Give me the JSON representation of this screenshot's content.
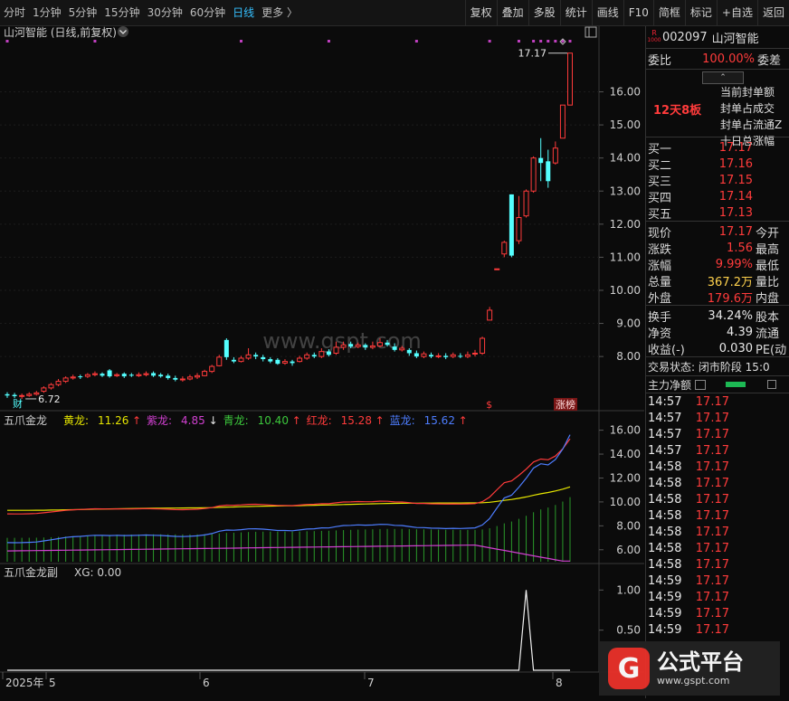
{
  "toolbar": {
    "periods": [
      "分时",
      "1分钟",
      "5分钟",
      "15分钟",
      "30分钟",
      "60分钟",
      "日线",
      "更多 〉"
    ],
    "active_period": "日线",
    "tools": [
      "复权",
      "叠加",
      "多股",
      "统计",
      "画线",
      "F10",
      "简框",
      "标记",
      "+自选",
      "返回"
    ]
  },
  "main_chart": {
    "title": "山河智能 (日线,前复权)",
    "high_label": "17.17",
    "low_label": "6.72",
    "cai_label": "财",
    "s_label": "$",
    "zhangbang_label": "涨榜",
    "watermark": "www.gspt.com",
    "price_axis": [
      "16.00",
      "15.00",
      "14.00",
      "13.00",
      "12.00",
      "11.00",
      "10.00",
      "9.00",
      "8.00"
    ]
  },
  "indicator1": {
    "name": "五爪金龙",
    "lines": [
      {
        "label": "黄龙:",
        "value": "11.26",
        "arrow": "↑",
        "color": "#e6e600"
      },
      {
        "label": "紫龙:",
        "value": "4.85",
        "arrow": "↓",
        "color": "#d040d0"
      },
      {
        "label": "青龙:",
        "value": "10.40",
        "arrow": "↑",
        "color": "#3cc83c"
      },
      {
        "label": "红龙:",
        "value": "15.28",
        "arrow": "↑",
        "color": "#ff3b3b"
      },
      {
        "label": "蓝龙:",
        "value": "15.62",
        "arrow": "↑",
        "color": "#4d7dff"
      }
    ],
    "axis": [
      "16.00",
      "14.00",
      "12.00",
      "10.00",
      "8.00",
      "6.00"
    ]
  },
  "indicator2": {
    "name": "五爪金龙副",
    "xg_label": "XG: 0.00",
    "axis": [
      "1.00",
      "0.50"
    ]
  },
  "time_axis": [
    "2025年",
    "5",
    "6",
    "7",
    "8"
  ],
  "stock": {
    "badge_top": "R",
    "badge_bottom": "1000",
    "code": "002097",
    "name": "山河智能"
  },
  "webi": {
    "label": "委比",
    "value": "100.00%",
    "label2": "委差"
  },
  "seal": {
    "days": "12天8板",
    "items": [
      "当前封单额",
      "封单占成交",
      "封单占流通Z",
      "十日总涨幅"
    ]
  },
  "order_book": [
    {
      "label": "买一",
      "price": "17.17"
    },
    {
      "label": "买二",
      "price": "17.16"
    },
    {
      "label": "买三",
      "price": "17.15"
    },
    {
      "label": "买四",
      "price": "17.14"
    },
    {
      "label": "买五",
      "price": "17.13"
    }
  ],
  "quote": [
    {
      "label": "现价",
      "value": "17.17",
      "color": "red",
      "label2": "今开"
    },
    {
      "label": "涨跌",
      "value": "1.56",
      "color": "red",
      "label2": "最高"
    },
    {
      "label": "涨幅",
      "value": "9.99%",
      "color": "red",
      "label2": "最低"
    },
    {
      "label": "总量",
      "value": "367.2万",
      "color": "yellow",
      "label2": "量比"
    },
    {
      "label": "外盘",
      "value": "179.6万",
      "color": "red",
      "label2": "内盘"
    }
  ],
  "quote2": [
    {
      "label": "换手",
      "value": "34.24%",
      "label2": "股本"
    },
    {
      "label": "净资",
      "value": "4.39",
      "label2": "流通"
    },
    {
      "label": "收益(-)",
      "value": "0.030",
      "label2": "PE(动"
    }
  ],
  "trade_state": "交易状态: 闭市阶段 15:0",
  "net_flow_label": "主力净额",
  "ticks": [
    {
      "time": "14:57",
      "price": "17.17"
    },
    {
      "time": "14:57",
      "price": "17.17"
    },
    {
      "time": "14:57",
      "price": "17.17"
    },
    {
      "time": "14:57",
      "price": "17.17"
    },
    {
      "time": "14:58",
      "price": "17.17"
    },
    {
      "time": "14:58",
      "price": "17.17"
    },
    {
      "time": "14:58",
      "price": "17.17"
    },
    {
      "time": "14:58",
      "price": "17.17"
    },
    {
      "time": "14:58",
      "price": "17.17"
    },
    {
      "time": "14:58",
      "price": "17.17"
    },
    {
      "time": "14:58",
      "price": "17.17"
    },
    {
      "time": "14:59",
      "price": "17.17"
    },
    {
      "time": "14:59",
      "price": "17.17"
    },
    {
      "time": "14:59",
      "price": "17.17"
    },
    {
      "time": "14:59",
      "price": "17.17"
    }
  ],
  "logo": {
    "mark": "G",
    "title": "公式平台",
    "url": "www.gspt.com"
  },
  "chart_data": {
    "type": "candlestick",
    "price_ylim": [
      6.5,
      17.6
    ],
    "candles": [
      [
        6.86,
        6.82,
        6.92,
        6.75
      ],
      [
        6.84,
        6.8,
        6.9,
        6.74
      ],
      [
        6.8,
        6.82,
        6.88,
        6.72
      ],
      [
        6.82,
        6.86,
        6.92,
        6.78
      ],
      [
        6.86,
        6.9,
        6.96,
        6.82
      ],
      [
        6.95,
        7.05,
        7.1,
        6.9
      ],
      [
        7.05,
        7.15,
        7.2,
        7.0
      ],
      [
        7.15,
        7.25,
        7.32,
        7.1
      ],
      [
        7.25,
        7.35,
        7.4,
        7.2
      ],
      [
        7.35,
        7.38,
        7.45,
        7.3
      ],
      [
        7.4,
        7.38,
        7.45,
        7.32
      ],
      [
        7.4,
        7.45,
        7.5,
        7.35
      ],
      [
        7.45,
        7.48,
        7.55,
        7.4
      ],
      [
        7.48,
        7.42,
        7.52,
        7.38
      ],
      [
        7.58,
        7.4,
        7.62,
        7.36
      ],
      [
        7.42,
        7.45,
        7.5,
        7.38
      ],
      [
        7.48,
        7.4,
        7.52,
        7.35
      ],
      [
        7.45,
        7.42,
        7.5,
        7.38
      ],
      [
        7.42,
        7.45,
        7.52,
        7.38
      ],
      [
        7.45,
        7.48,
        7.55,
        7.4
      ],
      [
        7.5,
        7.42,
        7.55,
        7.38
      ],
      [
        7.45,
        7.4,
        7.5,
        7.36
      ],
      [
        7.42,
        7.35,
        7.48,
        7.3
      ],
      [
        7.35,
        7.3,
        7.42,
        7.25
      ],
      [
        7.3,
        7.32,
        7.4,
        7.24
      ],
      [
        7.32,
        7.38,
        7.45,
        7.28
      ],
      [
        7.38,
        7.42,
        7.5,
        7.32
      ],
      [
        7.42,
        7.55,
        7.6,
        7.4
      ],
      [
        7.55,
        7.7,
        7.75,
        7.5
      ],
      [
        7.72,
        7.98,
        8.05,
        7.7
      ],
      [
        8.5,
        7.98,
        8.55,
        7.9
      ],
      [
        7.9,
        7.85,
        7.98,
        7.8
      ],
      [
        7.85,
        7.95,
        8.02,
        7.82
      ],
      [
        7.95,
        8.05,
        8.25,
        7.9
      ],
      [
        8.05,
        8.0,
        8.12,
        7.92
      ],
      [
        7.98,
        7.92,
        8.05,
        7.85
      ],
      [
        7.92,
        7.85,
        7.98,
        7.8
      ],
      [
        7.9,
        7.78,
        7.95,
        7.75
      ],
      [
        7.8,
        7.85,
        7.92,
        7.75
      ],
      [
        7.85,
        7.8,
        7.9,
        7.72
      ],
      [
        7.85,
        7.95,
        8.02,
        7.82
      ],
      [
        7.95,
        8.05,
        8.12,
        7.9
      ],
      [
        8.05,
        8.0,
        8.12,
        7.95
      ],
      [
        8.0,
        8.15,
        8.25,
        7.95
      ],
      [
        8.15,
        8.05,
        8.22,
        8.0
      ],
      [
        8.1,
        8.28,
        8.45,
        8.05
      ],
      [
        8.28,
        8.35,
        8.45,
        8.2
      ],
      [
        8.38,
        8.3,
        8.45,
        8.25
      ],
      [
        8.3,
        8.35,
        8.42,
        8.25
      ],
      [
        8.35,
        8.28,
        8.4,
        8.2
      ],
      [
        8.28,
        8.32,
        8.45,
        8.22
      ],
      [
        8.32,
        8.42,
        8.55,
        8.28
      ],
      [
        8.42,
        8.35,
        8.5,
        8.3
      ],
      [
        8.3,
        8.2,
        8.4,
        8.15
      ],
      [
        8.2,
        8.25,
        8.32,
        8.15
      ],
      [
        8.2,
        8.1,
        8.25,
        8.02
      ],
      [
        8.1,
        8.0,
        8.18,
        7.95
      ],
      [
        8.0,
        8.08,
        8.15,
        7.95
      ],
      [
        8.05,
        8.0,
        8.12,
        7.95
      ],
      [
        8.0,
        8.02,
        8.1,
        7.95
      ],
      [
        8.02,
        7.98,
        8.1,
        7.92
      ],
      [
        8.0,
        8.05,
        8.12,
        7.95
      ],
      [
        8.02,
        8.0,
        8.1,
        7.95
      ],
      [
        8.0,
        8.05,
        8.15,
        7.95
      ],
      [
        8.08,
        8.1,
        8.2,
        8.0
      ],
      [
        8.1,
        8.55,
        8.6,
        8.05
      ],
      [
        9.1,
        9.4,
        9.5,
        9.1
      ],
      [
        10.65,
        10.65,
        10.65,
        10.65
      ],
      [
        11.1,
        11.45,
        11.5,
        11.0
      ],
      [
        12.9,
        11.05,
        12.9,
        11.0
      ],
      [
        11.5,
        12.2,
        12.85,
        11.4
      ],
      [
        12.25,
        13.0,
        13.05,
        12.2
      ],
      [
        13.0,
        14.0,
        14.05,
        12.95
      ],
      [
        14.0,
        13.85,
        14.6,
        13.3
      ],
      [
        13.9,
        13.3,
        14.25,
        13.1
      ],
      [
        13.85,
        14.3,
        14.5,
        13.8
      ],
      [
        14.6,
        15.6,
        15.6,
        14.6
      ],
      [
        15.6,
        17.17,
        17.17,
        15.6
      ]
    ],
    "indicator_lines": [
      {
        "name": "黄龙",
        "last": 11.26
      },
      {
        "name": "紫龙",
        "last": 4.85
      },
      {
        "name": "青龙",
        "last": 10.4
      },
      {
        "name": "红龙",
        "last": 15.28
      },
      {
        "name": "蓝龙",
        "last": 15.62
      }
    ],
    "indicator_ylim": [
      5.0,
      16.5
    ],
    "xg_values_peak_index": 71,
    "xg_ylim": [
      0,
      1.15
    ]
  }
}
